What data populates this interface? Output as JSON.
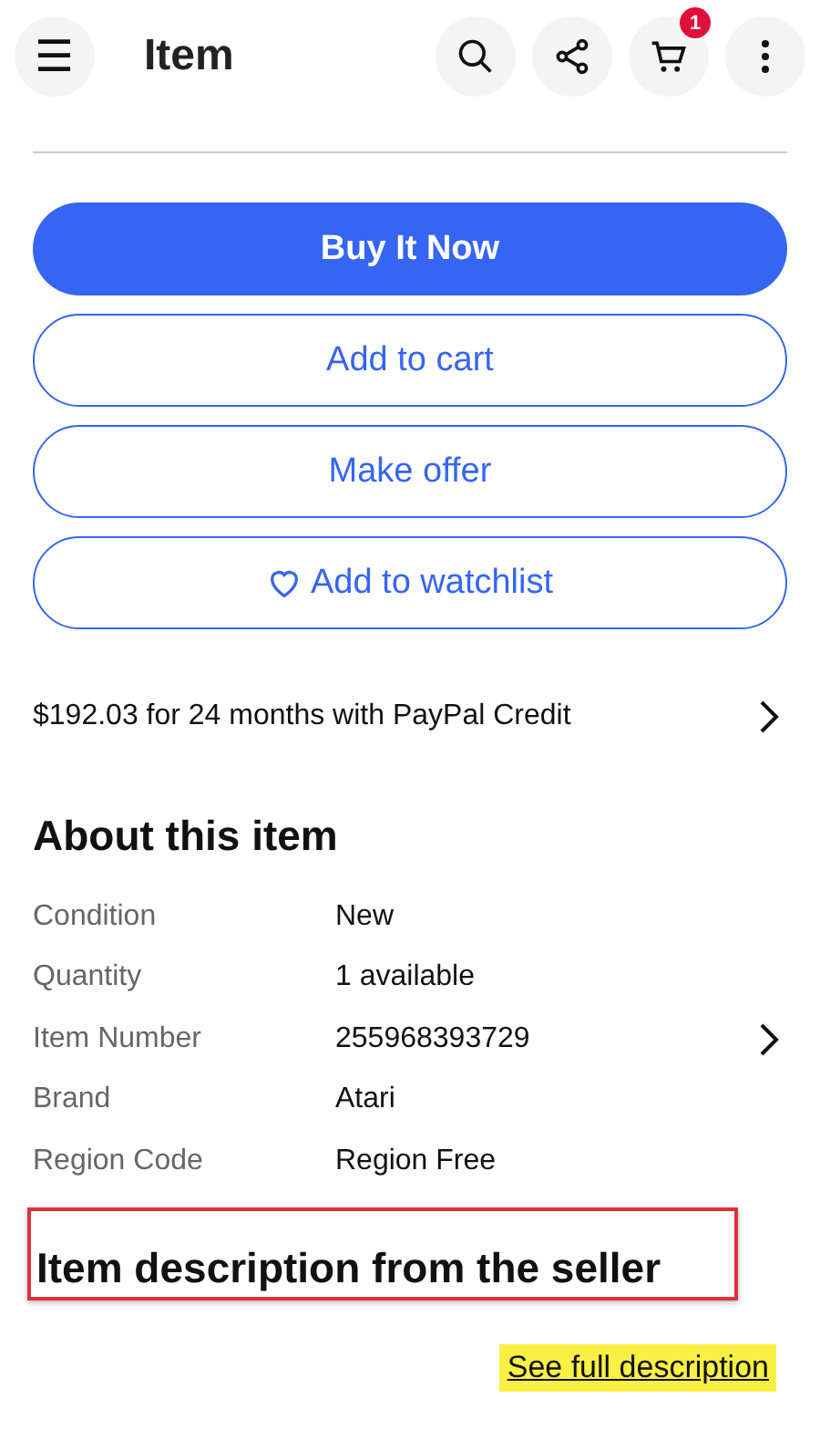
{
  "header": {
    "menu_icon": "☰",
    "title": "Item",
    "cart_badge": "1"
  },
  "actions": [
    {
      "label": "Buy It Now",
      "kind": "primary"
    },
    {
      "label": "Add to cart",
      "kind": "secondary"
    },
    {
      "label": "Make offer",
      "kind": "secondary"
    },
    {
      "label": "Add to watchlist",
      "kind": "watch"
    }
  ],
  "financing": {
    "text": "$192.03 for 24 months with PayPal Credit"
  },
  "about": {
    "title": "About this item",
    "rows": [
      {
        "label": "Condition",
        "value": "New",
        "link": false
      },
      {
        "label": "Quantity",
        "value": "1 available",
        "link": false
      },
      {
        "label": "Item Number",
        "value": "255968393729",
        "link": true
      },
      {
        "label": "Brand",
        "value": "Atari",
        "link": false
      },
      {
        "label": "Region Code",
        "value": "Region Free",
        "link": false
      }
    ]
  },
  "description": {
    "title": "Item description from the seller",
    "outlined": true,
    "link": "See full description",
    "highlighted": true
  }
}
